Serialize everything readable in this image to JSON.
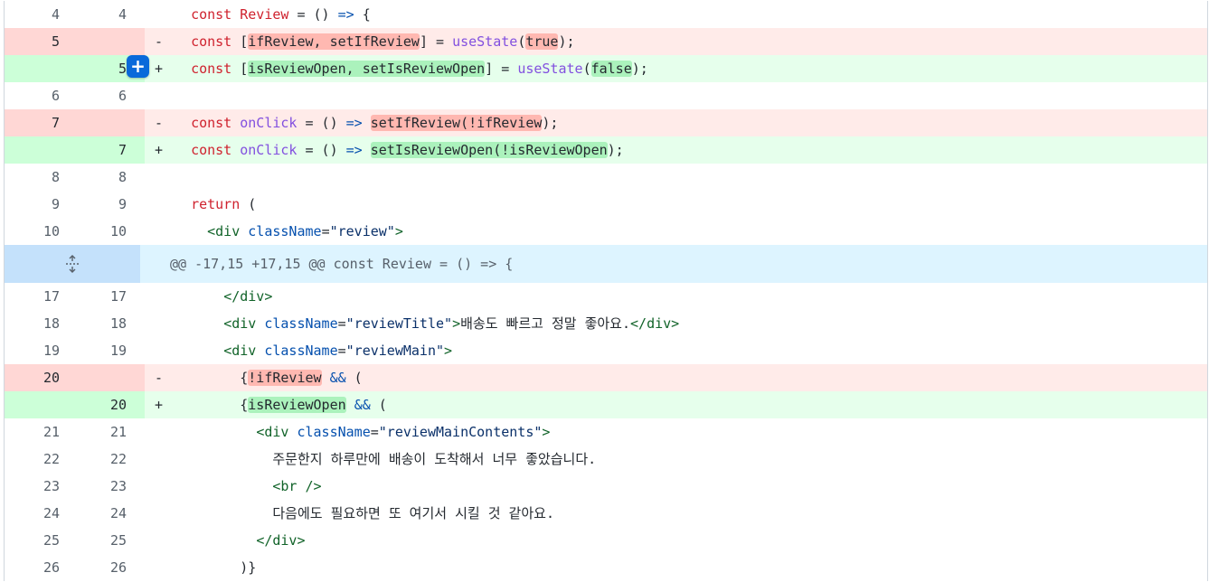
{
  "diff": {
    "rows_a": [
      {
        "type": "ctx",
        "old": "4",
        "new": "4",
        "marker": "",
        "indent": "  ",
        "parts": [
          {
            "c": "k",
            "t": "const "
          },
          {
            "c": "k",
            "t": "Review"
          },
          {
            "c": "plain",
            "t": " = () "
          },
          {
            "c": "a",
            "t": "=>"
          },
          {
            "c": "plain",
            "t": " {"
          }
        ]
      },
      {
        "type": "del",
        "old": "5",
        "new": "",
        "marker": "-",
        "indent": "  ",
        "parts": [
          {
            "c": "k",
            "t": "const "
          },
          {
            "c": "plain",
            "t": "["
          },
          {
            "c": "hl-del",
            "t": "ifReview, setIfReview"
          },
          {
            "c": "plain",
            "t": "] = "
          },
          {
            "c": "f",
            "t": "useState"
          },
          {
            "c": "plain",
            "t": "("
          },
          {
            "c": "hl-del",
            "t": "true"
          },
          {
            "c": "plain",
            "t": ");"
          }
        ]
      },
      {
        "type": "add",
        "old": "",
        "new": "5",
        "marker": "+",
        "indent": "  ",
        "parts": [
          {
            "c": "k",
            "t": "const "
          },
          {
            "c": "plain",
            "t": "["
          },
          {
            "c": "hl-add",
            "t": "isReviewOpen, setIsReviewOpen"
          },
          {
            "c": "plain",
            "t": "] = "
          },
          {
            "c": "f",
            "t": "useState"
          },
          {
            "c": "plain",
            "t": "("
          },
          {
            "c": "hl-add",
            "t": "false"
          },
          {
            "c": "plain",
            "t": ");"
          }
        ]
      },
      {
        "type": "ctx",
        "old": "6",
        "new": "6",
        "marker": "",
        "indent": "",
        "parts": []
      },
      {
        "type": "del",
        "old": "7",
        "new": "",
        "marker": "-",
        "indent": "  ",
        "parts": [
          {
            "c": "k",
            "t": "const "
          },
          {
            "c": "f",
            "t": "onClick"
          },
          {
            "c": "plain",
            "t": " = () "
          },
          {
            "c": "a",
            "t": "=>"
          },
          {
            "c": "plain",
            "t": " "
          },
          {
            "c": "hl-del",
            "t": "setIfReview(!ifReview"
          },
          {
            "c": "plain",
            "t": ");"
          }
        ]
      },
      {
        "type": "add",
        "old": "",
        "new": "7",
        "marker": "+",
        "indent": "  ",
        "parts": [
          {
            "c": "k",
            "t": "const "
          },
          {
            "c": "f",
            "t": "onClick"
          },
          {
            "c": "plain",
            "t": " = () "
          },
          {
            "c": "a",
            "t": "=>"
          },
          {
            "c": "plain",
            "t": " "
          },
          {
            "c": "hl-add",
            "t": "setIsReviewOpen(!isReviewOpen"
          },
          {
            "c": "plain",
            "t": ");"
          }
        ]
      },
      {
        "type": "ctx",
        "old": "8",
        "new": "8",
        "marker": "",
        "indent": "",
        "parts": []
      },
      {
        "type": "ctx",
        "old": "9",
        "new": "9",
        "marker": "",
        "indent": "  ",
        "parts": [
          {
            "c": "k",
            "t": "return"
          },
          {
            "c": "plain",
            "t": " ("
          }
        ]
      },
      {
        "type": "ctx",
        "old": "10",
        "new": "10",
        "marker": "",
        "indent": "    ",
        "parts": [
          {
            "c": "t",
            "t": "<div "
          },
          {
            "c": "a",
            "t": "className"
          },
          {
            "c": "plain",
            "t": "="
          },
          {
            "c": "s",
            "t": "\"review\""
          },
          {
            "c": "t",
            "t": ">"
          }
        ]
      }
    ],
    "hunk_header": "@@ -17,15 +17,15 @@ const Review = () => {",
    "rows_b": [
      {
        "type": "ctx",
        "old": "17",
        "new": "17",
        "marker": "",
        "indent": "      ",
        "parts": [
          {
            "c": "t",
            "t": "</div>"
          }
        ]
      },
      {
        "type": "ctx",
        "old": "18",
        "new": "18",
        "marker": "",
        "indent": "      ",
        "parts": [
          {
            "c": "t",
            "t": "<div "
          },
          {
            "c": "a",
            "t": "className"
          },
          {
            "c": "plain",
            "t": "="
          },
          {
            "c": "s",
            "t": "\"reviewTitle\""
          },
          {
            "c": "t",
            "t": ">"
          },
          {
            "c": "plain",
            "t": "배송도 빠르고 정말 좋아요."
          },
          {
            "c": "t",
            "t": "</div>"
          }
        ]
      },
      {
        "type": "ctx",
        "old": "19",
        "new": "19",
        "marker": "",
        "indent": "      ",
        "parts": [
          {
            "c": "t",
            "t": "<div "
          },
          {
            "c": "a",
            "t": "className"
          },
          {
            "c": "plain",
            "t": "="
          },
          {
            "c": "s",
            "t": "\"reviewMain\""
          },
          {
            "c": "t",
            "t": ">"
          }
        ]
      },
      {
        "type": "del",
        "old": "20",
        "new": "",
        "marker": "-",
        "indent": "        ",
        "parts": [
          {
            "c": "plain",
            "t": "{"
          },
          {
            "c": "hl-del",
            "t": "!ifReview"
          },
          {
            "c": "plain",
            "t": " "
          },
          {
            "c": "a",
            "t": "&&"
          },
          {
            "c": "plain",
            "t": " ("
          }
        ]
      },
      {
        "type": "add",
        "old": "",
        "new": "20",
        "marker": "+",
        "indent": "        ",
        "parts": [
          {
            "c": "plain",
            "t": "{"
          },
          {
            "c": "hl-add",
            "t": "isReviewOpen"
          },
          {
            "c": "plain",
            "t": " "
          },
          {
            "c": "a",
            "t": "&&"
          },
          {
            "c": "plain",
            "t": " ("
          }
        ]
      },
      {
        "type": "ctx",
        "old": "21",
        "new": "21",
        "marker": "",
        "indent": "          ",
        "parts": [
          {
            "c": "t",
            "t": "<div "
          },
          {
            "c": "a",
            "t": "className"
          },
          {
            "c": "plain",
            "t": "="
          },
          {
            "c": "s",
            "t": "\"reviewMainContents\""
          },
          {
            "c": "t",
            "t": ">"
          }
        ]
      },
      {
        "type": "ctx",
        "old": "22",
        "new": "22",
        "marker": "",
        "indent": "            ",
        "parts": [
          {
            "c": "plain",
            "t": "주문한지 하루만에 배송이 도착해서 너무 좋았습니다."
          }
        ]
      },
      {
        "type": "ctx",
        "old": "23",
        "new": "23",
        "marker": "",
        "indent": "            ",
        "parts": [
          {
            "c": "t",
            "t": "<br "
          },
          {
            "c": "t",
            "t": "/>"
          }
        ]
      },
      {
        "type": "ctx",
        "old": "24",
        "new": "24",
        "marker": "",
        "indent": "            ",
        "parts": [
          {
            "c": "plain",
            "t": "다음에도 필요하면 또 여기서 시킬 것 같아요."
          }
        ]
      },
      {
        "type": "ctx",
        "old": "25",
        "new": "25",
        "marker": "",
        "indent": "          ",
        "parts": [
          {
            "c": "t",
            "t": "</div>"
          }
        ]
      },
      {
        "type": "ctx",
        "old": "26",
        "new": "26",
        "marker": "",
        "indent": "        ",
        "parts": [
          {
            "c": "plain",
            "t": ")}"
          }
        ]
      }
    ]
  },
  "add_comment_button": {
    "label": "+"
  },
  "icons": {
    "expand": "expand-icon",
    "add": "plus-icon"
  },
  "colors": {
    "deletion_bg": "#ffebe9",
    "deletion_num_bg": "#ffd7d5",
    "deletion_highlight": "#ffb8b1",
    "addition_bg": "#e6ffec",
    "addition_num_bg": "#ccffd8",
    "addition_highlight": "#abf2bc",
    "hunk_bg": "#ddf4ff",
    "hunk_num_bg": "#c4e1fb",
    "accent": "#0969da"
  }
}
